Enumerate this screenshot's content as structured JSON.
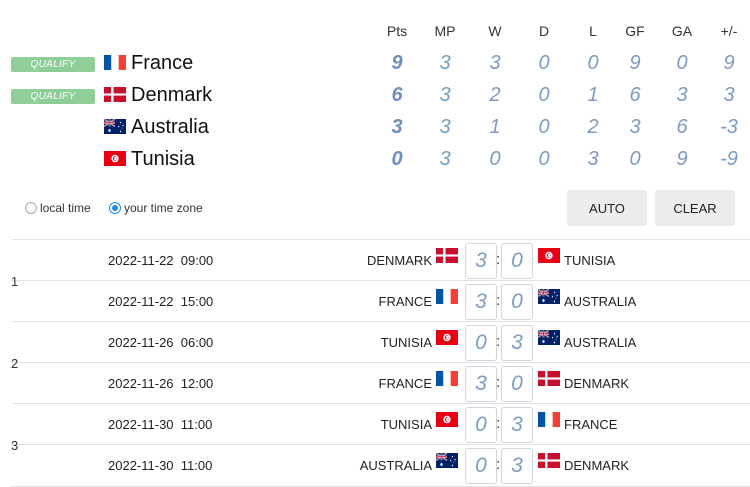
{
  "columns": [
    "Pts",
    "MP",
    "W",
    "D",
    "L",
    "GF",
    "GA",
    "+/-"
  ],
  "qualify_label": "QUALIFY",
  "standings": [
    {
      "team": "France",
      "flag": "fr",
      "qualify": true,
      "stats": [
        "9",
        "3",
        "3",
        "0",
        "0",
        "9",
        "0",
        "9"
      ]
    },
    {
      "team": "Denmark",
      "flag": "dk",
      "qualify": true,
      "stats": [
        "6",
        "3",
        "2",
        "0",
        "1",
        "6",
        "3",
        "3"
      ]
    },
    {
      "team": "Australia",
      "flag": "au",
      "qualify": false,
      "stats": [
        "3",
        "3",
        "1",
        "0",
        "2",
        "3",
        "6",
        "-3"
      ]
    },
    {
      "team": "Tunisia",
      "flag": "tn",
      "qualify": false,
      "stats": [
        "0",
        "3",
        "0",
        "0",
        "3",
        "0",
        "9",
        "-9"
      ]
    }
  ],
  "timezone": {
    "local_label": "local time",
    "yours_label": "your time zone",
    "selected": "yours"
  },
  "buttons": {
    "auto": "AUTO",
    "clear": "CLEAR"
  },
  "rounds": [
    "1",
    "2",
    "3"
  ],
  "matches": [
    {
      "datetime": "2022-11-22  09:00",
      "home": "DENMARK",
      "home_flag": "dk",
      "home_score": "3",
      "away_score": "0",
      "away": "TUNISIA",
      "away_flag": "tn"
    },
    {
      "datetime": "2022-11-22  15:00",
      "home": "FRANCE",
      "home_flag": "fr",
      "home_score": "3",
      "away_score": "0",
      "away": "AUSTRALIA",
      "away_flag": "au"
    },
    {
      "datetime": "2022-11-26  06:00",
      "home": "TUNISIA",
      "home_flag": "tn",
      "home_score": "0",
      "away_score": "3",
      "away": "AUSTRALIA",
      "away_flag": "au"
    },
    {
      "datetime": "2022-11-26  12:00",
      "home": "FRANCE",
      "home_flag": "fr",
      "home_score": "3",
      "away_score": "0",
      "away": "DENMARK",
      "away_flag": "dk"
    },
    {
      "datetime": "2022-11-30  11:00",
      "home": "TUNISIA",
      "home_flag": "tn",
      "home_score": "0",
      "away_score": "3",
      "away": "FRANCE",
      "away_flag": "fr"
    },
    {
      "datetime": "2022-11-30  11:00",
      "home": "AUSTRALIA",
      "home_flag": "au",
      "home_score": "0",
      "away_score": "3",
      "away": "DENMARK",
      "away_flag": "dk"
    }
  ],
  "colors": {
    "qualify": "#8fcf97",
    "score": "#7d9ac0",
    "radio_on": "#1e88e5"
  }
}
